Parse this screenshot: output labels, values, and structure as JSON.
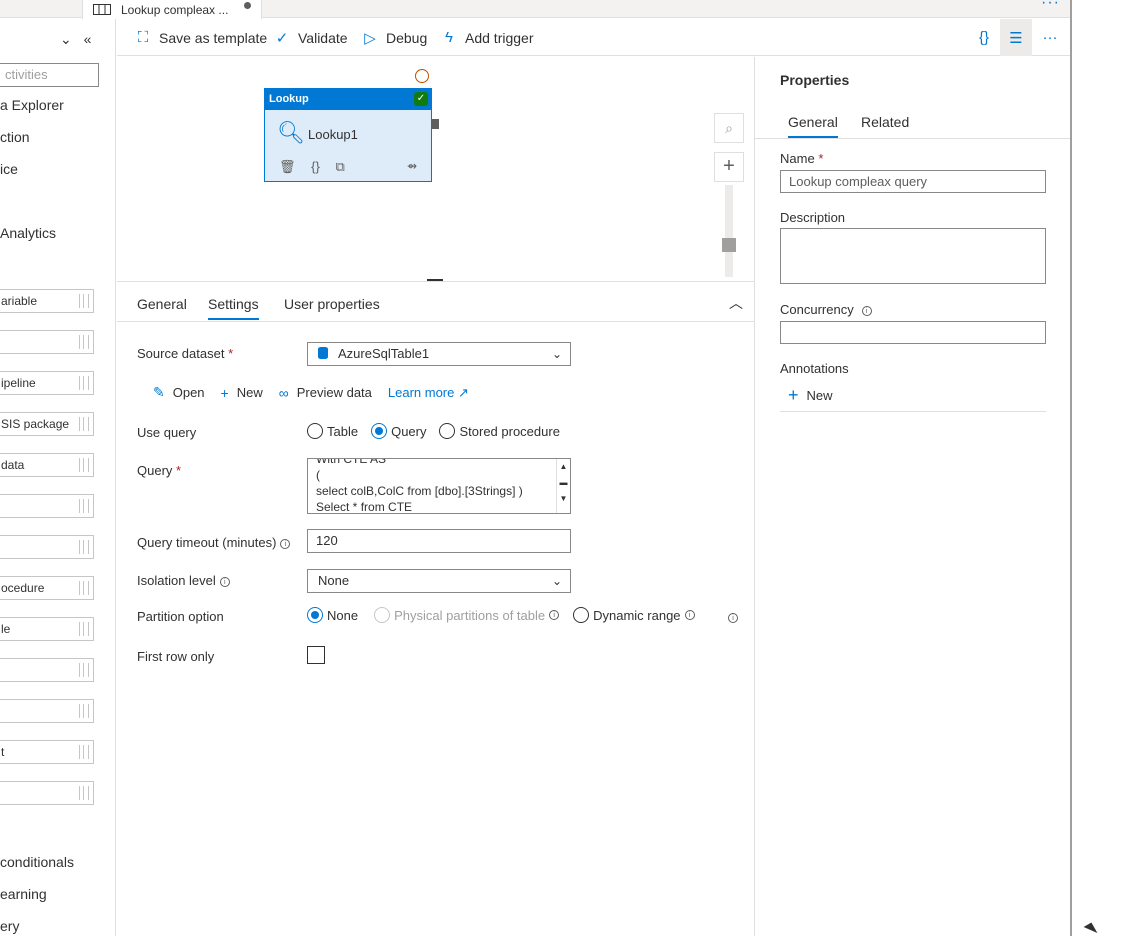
{
  "tab": {
    "title": "Lookup compleax ..."
  },
  "sidebar": {
    "search_placeholder": "ctivities",
    "categories": [
      {
        "label": "a Explorer"
      },
      {
        "label": "ction"
      },
      {
        "label": "ice"
      },
      {
        "label": "Analytics"
      },
      {
        "label": " conditionals"
      },
      {
        "label": "earning"
      },
      {
        "label": "ery"
      }
    ],
    "items": [
      {
        "label": "ariable"
      },
      {
        "label": ""
      },
      {
        "label": "ipeline"
      },
      {
        "label": "SIS package"
      },
      {
        "label": "data"
      },
      {
        "label": ""
      },
      {
        "label": ""
      },
      {
        "label": "ocedure"
      },
      {
        "label": "le"
      },
      {
        "label": ""
      },
      {
        "label": ""
      },
      {
        "label": "t"
      },
      {
        "label": ""
      }
    ]
  },
  "toolbar": {
    "save_template": "Save as template",
    "validate": "Validate",
    "debug": "Debug",
    "add_trigger": "Add trigger"
  },
  "canvas": {
    "activity_type": "Lookup",
    "activity_name": "Lookup1"
  },
  "bottom_tabs": [
    {
      "label": "General"
    },
    {
      "label": "Settings"
    },
    {
      "label": "User properties"
    }
  ],
  "settings": {
    "source_dataset_label": "Source dataset",
    "source_dataset_value": "AzureSqlTable1",
    "open": "Open",
    "new": "New",
    "preview": "Preview data",
    "learn_more": "Learn more",
    "use_query_label": "Use query",
    "use_query_options": [
      "Table",
      "Query",
      "Stored procedure"
    ],
    "query_label": "Query",
    "query_lines": [
      "With CTE AS",
      "(",
      "select colB,ColC from [dbo].[3Strings] )",
      "Select * from CTE"
    ],
    "timeout_label": "Query timeout (minutes)",
    "timeout_value": "120",
    "isolation_label": "Isolation level",
    "isolation_value": "None",
    "partition_label": "Partition option",
    "partition_options": [
      "None",
      "Physical partitions of table",
      "Dynamic range"
    ],
    "first_row_label": "First row only"
  },
  "properties": {
    "title": "Properties",
    "tab_general": "General",
    "tab_related": "Related",
    "name_label": "Name",
    "name_value": "Lookup compleax query",
    "description_label": "Description",
    "concurrency_label": "Concurrency",
    "annotations_label": "Annotations",
    "annotations_new": "New"
  },
  "colors": {
    "accent": "#0078d4",
    "success": "#107c10"
  }
}
